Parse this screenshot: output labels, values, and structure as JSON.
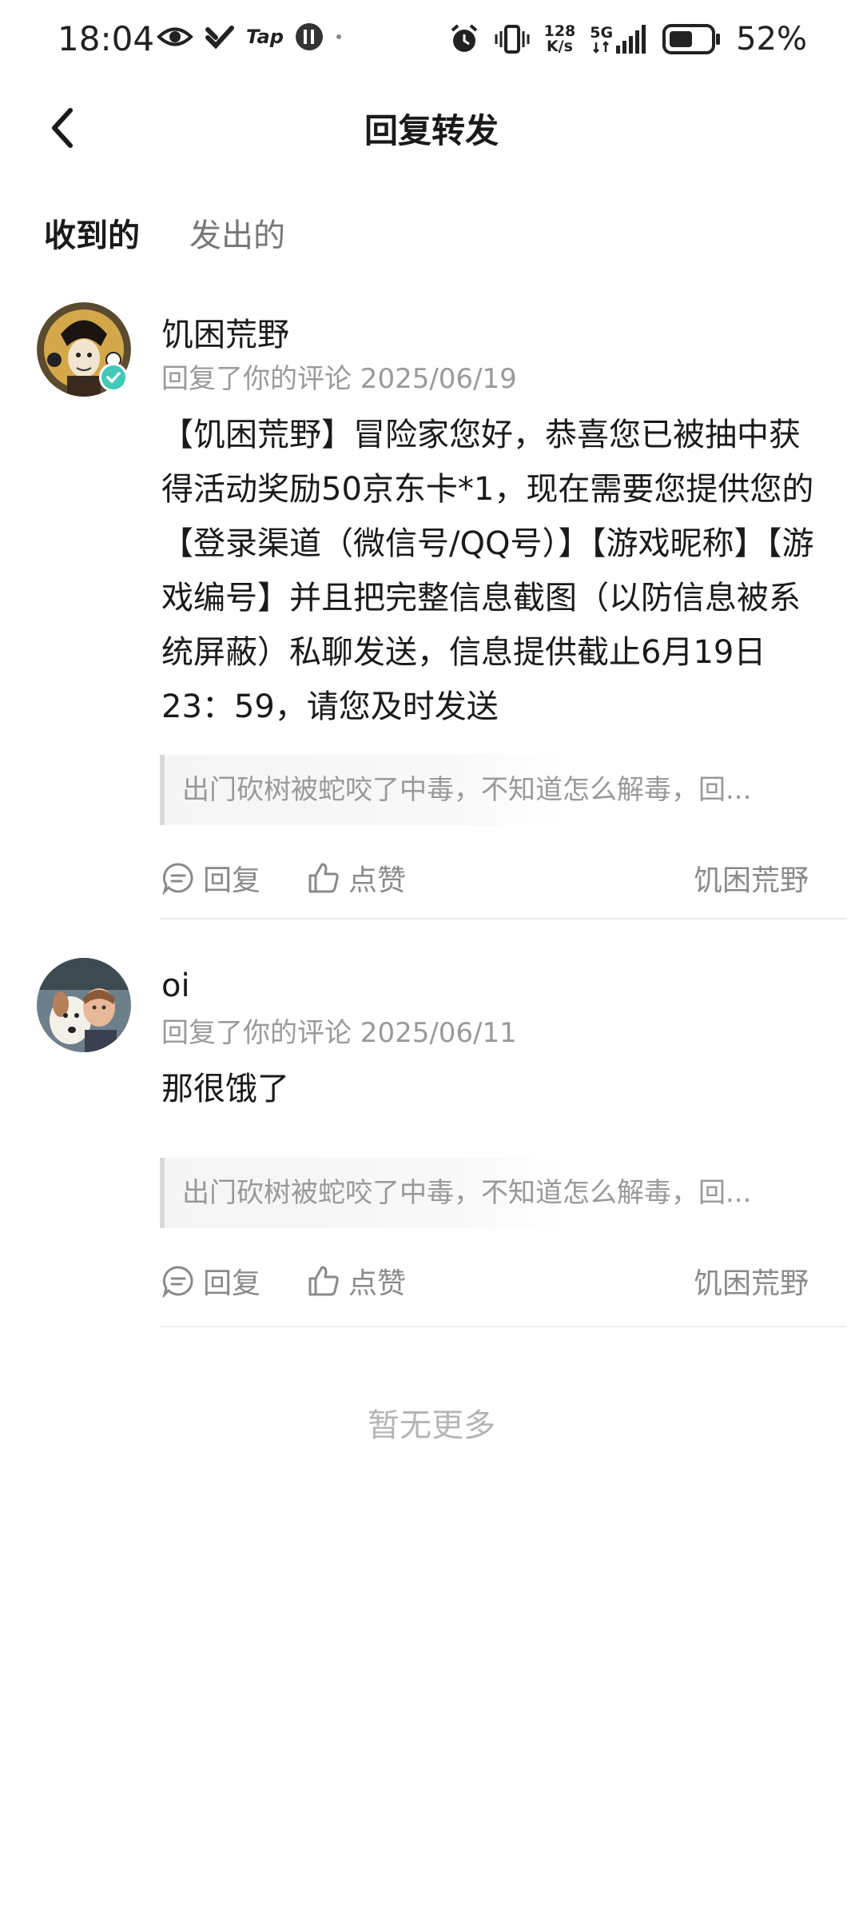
{
  "status_bar": {
    "time": "18:04",
    "tap_label": "Tap",
    "speed_value": "128",
    "speed_unit": "K/s",
    "network": "5G",
    "battery": "52%",
    "left_icons": [
      "eye-icon",
      "app-check-icon",
      "tap-icon",
      "app-circle-icon",
      "dot-icon"
    ],
    "right_icons": [
      "alarm-icon",
      "vibrate-icon",
      "signal-icon",
      "battery-icon"
    ]
  },
  "header": {
    "title": "回复转发",
    "back_icon": "back-arrow-icon"
  },
  "tabs": [
    {
      "label": "收到的",
      "active": true
    },
    {
      "label": "发出的",
      "active": false
    }
  ],
  "messages": [
    {
      "name": "饥困荒野",
      "meta": "回复了你的评论 2025/06/19",
      "verified": true,
      "body": "【饥困荒野】冒险家您好，恭喜您已被抽中获得活动奖励50京东卡*1，现在需要您提供您的【登录渠道（微信号/QQ号）】【游戏昵称】【游戏编号】并且把完整信息截图（以防信息被系统屏蔽）私聊发送，信息提供截止6月19日23：59，请您及时发送",
      "quote": "出门砍树被蛇咬了中毒，不知道怎么解毒，回...",
      "reply_label": "回复",
      "like_label": "点赞",
      "source": "饥困荒野"
    },
    {
      "name": "oi",
      "meta": "回复了你的评论 2025/06/11",
      "verified": false,
      "body": "那很饿了",
      "quote": "出门砍树被蛇咬了中毒，不知道怎么解毒，回...",
      "reply_label": "回复",
      "like_label": "点赞",
      "source": "饥困荒野"
    }
  ],
  "footer": {
    "end_text": "暂无更多"
  },
  "colors": {
    "accent": "#7ddcd1",
    "verified": "#41c9b8",
    "muted_text": "#9a9a9a"
  }
}
